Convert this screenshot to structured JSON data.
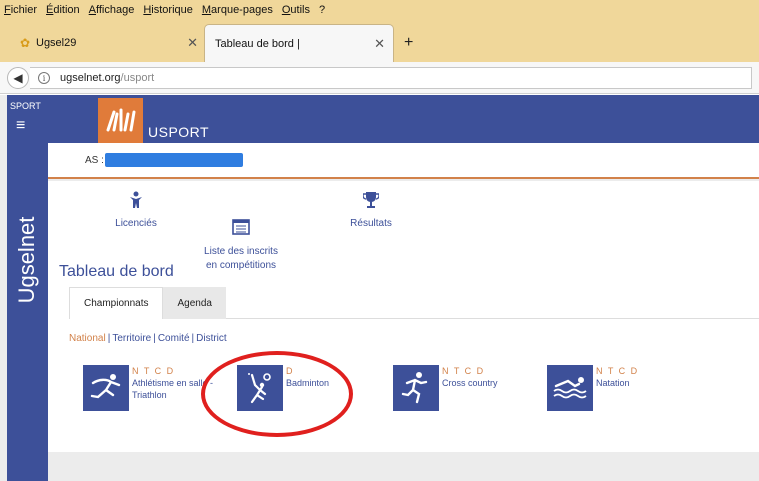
{
  "menu": [
    "Fichier",
    "Édition",
    "Affichage",
    "Historique",
    "Marque-pages",
    "Outils",
    "?"
  ],
  "tabs": [
    {
      "title": "Ugsel29",
      "active": false
    },
    {
      "title": "Tableau de bord |",
      "active": true
    }
  ],
  "url": {
    "host": "ugselnet.org",
    "path": "/usport"
  },
  "sidebar": {
    "label": "SPORT",
    "vertical": "Ugselnet"
  },
  "brand": {
    "name": "USPORT"
  },
  "as_bar": {
    "label": "AS :"
  },
  "quick_links": [
    {
      "label": "Licenciés",
      "icon": "person-icon"
    },
    {
      "label": "Liste des inscrits\nen compétitions",
      "icon": "list-icon"
    },
    {
      "label": "Résultats",
      "icon": "trophy-icon"
    }
  ],
  "page_title": "Tableau de bord",
  "content_tabs": [
    "Championnats",
    "Agenda"
  ],
  "filters": [
    "National",
    "Territoire",
    "Comité",
    "District"
  ],
  "sports": [
    {
      "levels": "N T C D",
      "name": "Athlétisme en salle - Triathlon",
      "icon": "athletics-icon"
    },
    {
      "levels": "D",
      "name": "Badminton",
      "icon": "badminton-icon"
    },
    {
      "levels": "N T C D",
      "name": "Cross country",
      "icon": "running-icon"
    },
    {
      "levels": "N T C D",
      "name": "Natation",
      "icon": "swimming-icon"
    }
  ],
  "colors": {
    "brand_blue": "#3d5099",
    "accent_orange": "#d2824a",
    "highlight_red": "#e0201e",
    "browser_chrome": "#f0d79a"
  }
}
